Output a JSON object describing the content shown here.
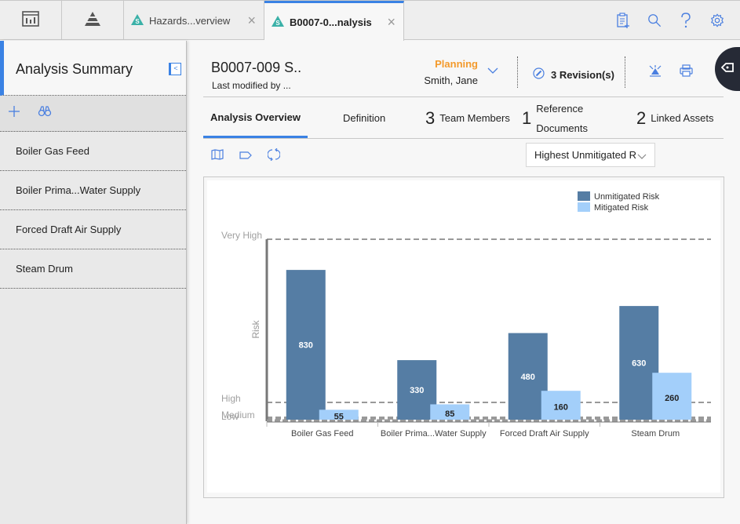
{
  "topbar": {
    "icon_tabs": [
      {
        "icon": "dashboard-icon"
      },
      {
        "icon": "pyramid-icon"
      }
    ],
    "doc_tabs": [
      {
        "label": "Hazards...verview",
        "icon": "hazards-icon",
        "close": "×",
        "active": false
      },
      {
        "label": "B0007-0...nalysis",
        "icon": "hazards-icon",
        "close": "×",
        "active": true
      }
    ],
    "actions": [
      "new-record-icon",
      "search-icon",
      "help-icon",
      "settings-icon"
    ]
  },
  "sidebar": {
    "title": "Analysis Summary",
    "collapse_glyph": "<",
    "tools": [
      "add-icon",
      "binoculars-icon"
    ],
    "items": [
      {
        "label": "Boiler Gas Feed"
      },
      {
        "label": "Boiler Prima...Water Supply"
      },
      {
        "label": "Forced Draft Air Supply"
      },
      {
        "label": "Steam Drum"
      }
    ]
  },
  "record": {
    "title": "B0007-009 S..",
    "subtitle": "Last modified by ...",
    "state": "Planning",
    "state_user": "Smith, Jane",
    "revisions": "3 Revision(s)",
    "accent": "#3a82e4",
    "state_color": "#f39a2c"
  },
  "tabs": [
    {
      "label": "Analysis Overview",
      "count": "",
      "active": true
    },
    {
      "label": "Definition",
      "count": "",
      "active": false
    },
    {
      "label": "Team Members",
      "count": "3",
      "active": false
    },
    {
      "label_line1": "Reference",
      "label_line2": "Documents",
      "count": "1",
      "active": false
    },
    {
      "label": "Linked Assets",
      "count": "2",
      "active": false
    }
  ],
  "chart_toolbar": {
    "icons": [
      "map-icon",
      "tag-icon",
      "refresh-icon"
    ],
    "select_value": "Highest Unmitigated R"
  },
  "chart_data": {
    "type": "bar",
    "title": "",
    "xlabel": "",
    "ylabel": "Risk",
    "ylim": [
      0,
      1000
    ],
    "categories": [
      "Boiler Gas Feed",
      "Boiler Prima...Water Supply",
      "Forced Draft Air Supply",
      "Steam Drum"
    ],
    "series": [
      {
        "name": "Unmitigated Risk",
        "color": "#557da4",
        "values": [
          830,
          330,
          480,
          630
        ]
      },
      {
        "name": "Mitigated Risk",
        "color": "#a3cffa",
        "values": [
          55,
          85,
          160,
          260
        ]
      }
    ],
    "thresholds": [
      {
        "label": "Very High",
        "value": 1000
      },
      {
        "label": "High",
        "value": 100
      },
      {
        "label": "Medium",
        "value": 10
      },
      {
        "label": "Low",
        "value": 1
      }
    ],
    "legend": "top-right",
    "grid": false
  }
}
